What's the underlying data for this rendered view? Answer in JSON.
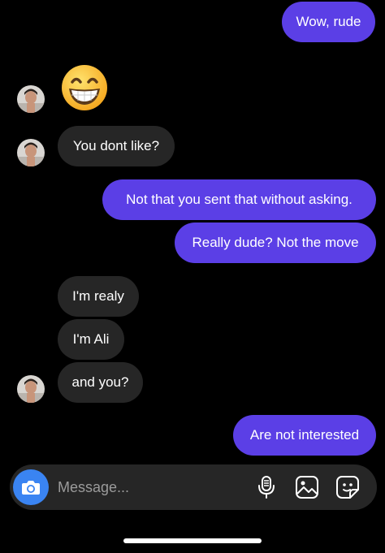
{
  "thread": {
    "messages": [
      {
        "from": "me",
        "text": "Wow, rude"
      },
      {
        "from": "them",
        "text": "😁"
      },
      {
        "from": "them",
        "text": "You dont like?"
      },
      {
        "from": "me",
        "text": "Not that you sent that without asking."
      },
      {
        "from": "me",
        "text": "Really dude? Not the move"
      },
      {
        "from": "them",
        "text": "I'm realy"
      },
      {
        "from": "them",
        "text": "I'm Ali"
      },
      {
        "from": "them",
        "text": "and you?"
      },
      {
        "from": "me",
        "text": "Are not interested"
      }
    ]
  },
  "composer": {
    "placeholder": "Message...",
    "icons": [
      "camera-icon",
      "microphone-icon",
      "gallery-icon",
      "sticker-icon"
    ],
    "camera_color": "#3a84f2"
  },
  "colors": {
    "outgoing_bubble": "#5b3fe6",
    "incoming_bubble": "#262626",
    "background": "#000000"
  }
}
